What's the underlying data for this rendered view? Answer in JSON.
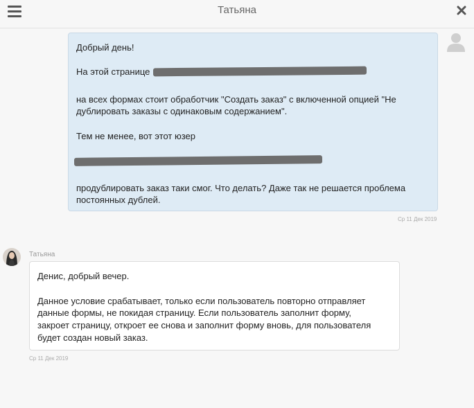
{
  "header": {
    "title": "Татьяна"
  },
  "messages": [
    {
      "direction": "outgoing",
      "lines": [
        "Добрый день!",
        "На этой странице",
        "на всех формах стоит обработчик \"Создать заказ\" с включенной опцией \"Не",
        "дублировать заказы с одинаковым содержанием\".",
        "Тем не менее, вот этот юзер",
        "продублировать заказ таки смог. Что делать? Даже так не решается проблема",
        "постоянных дублей."
      ],
      "timestamp": "Ср 11 Дек 2019"
    },
    {
      "direction": "incoming",
      "sender": "Татьяна",
      "lines": [
        "Денис, добрый вечер.",
        "Данное условие срабатывает, только если пользователь повторно отправляет",
        "данные формы, не покидая страницу. Если пользователь заполнит форму,",
        "закроет страницу, откроет ее снова и заполнит форму вновь, для пользователя",
        "будет создан новый заказ."
      ],
      "timestamp": "Ср 11 Дек 2019"
    }
  ],
  "colors": {
    "outgoing_bubble": "#deebf5",
    "incoming_bubble": "#ffffff",
    "background": "#f7f7f7",
    "redaction": "#6e6e6e"
  },
  "icons": {
    "menu": "hamburger-icon",
    "close": "close-icon",
    "avatar_placeholder": "user-silhouette-icon"
  }
}
